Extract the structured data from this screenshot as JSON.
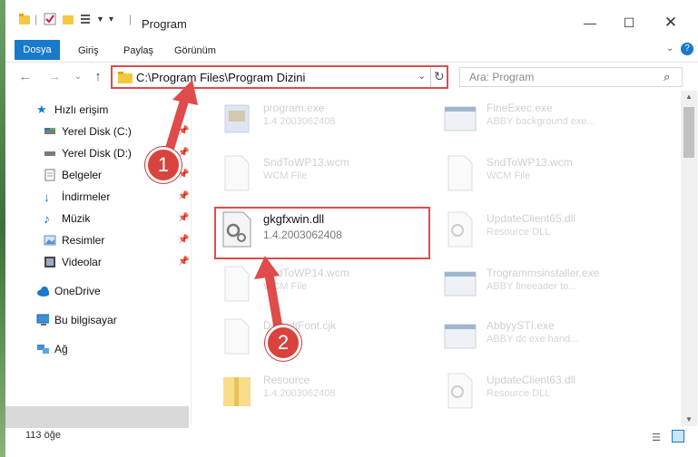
{
  "window": {
    "title": "Program"
  },
  "ribbon": {
    "tabs": [
      "Dosya",
      "Giriş",
      "Paylaş",
      "Görünüm"
    ]
  },
  "address": {
    "path": "C:\\Program Files\\Program Dizini"
  },
  "search": {
    "placeholder": "Ara: Program"
  },
  "sidebar": {
    "items": [
      {
        "label": "Hızlı erişim",
        "icon": "star-icon"
      },
      {
        "label": "Yerel Disk (C:)",
        "icon": "drive-icon"
      },
      {
        "label": "Yerel Disk (D:)",
        "icon": "drive-icon"
      },
      {
        "label": "Belgeler",
        "icon": "document-icon"
      },
      {
        "label": "İndirmeler",
        "icon": "download-icon"
      },
      {
        "label": "Müzik",
        "icon": "music-icon"
      },
      {
        "label": "Resimler",
        "icon": "pictures-icon"
      },
      {
        "label": "Videolar",
        "icon": "video-icon"
      },
      {
        "label": "OneDrive",
        "icon": "cloud-icon"
      },
      {
        "label": "Bu bilgisayar",
        "icon": "computer-icon"
      },
      {
        "label": "Ağ",
        "icon": "network-icon"
      }
    ]
  },
  "files": [
    {
      "name": "program.exe",
      "desc": "1.4.2003062408"
    },
    {
      "name": "FineExec.exe",
      "desc": "ABBY background exe..."
    },
    {
      "name": "SndToWP13.wcm",
      "desc": "WCM File"
    },
    {
      "name": "SndToWP13.wcm",
      "desc": "WCM File"
    },
    {
      "name": "gkgfxwin.dll",
      "desc": "1.4.2003062408"
    },
    {
      "name": "UpdateClient65.dll",
      "desc": "Resource DLL"
    },
    {
      "name": "SndToWP14.wcm",
      "desc": "WCM File"
    },
    {
      "name": "Trogrammsinstaller.exe",
      "desc": "ABBY fineeader to..."
    },
    {
      "name": "DefaultFont.cjk",
      "desc": ""
    },
    {
      "name": "AbbyySTI.exe",
      "desc": "ABBY dc exe hand..."
    },
    {
      "name": "Resource",
      "desc": "1.4.2003062408"
    },
    {
      "name": "UpdateClient63.dll",
      "desc": "Resource DLL"
    }
  ],
  "status": {
    "count": "113 öğe"
  },
  "callouts": {
    "one": "1",
    "two": "2"
  },
  "colors": {
    "accent": "#1979ca",
    "highlight": "#e04b4b"
  }
}
